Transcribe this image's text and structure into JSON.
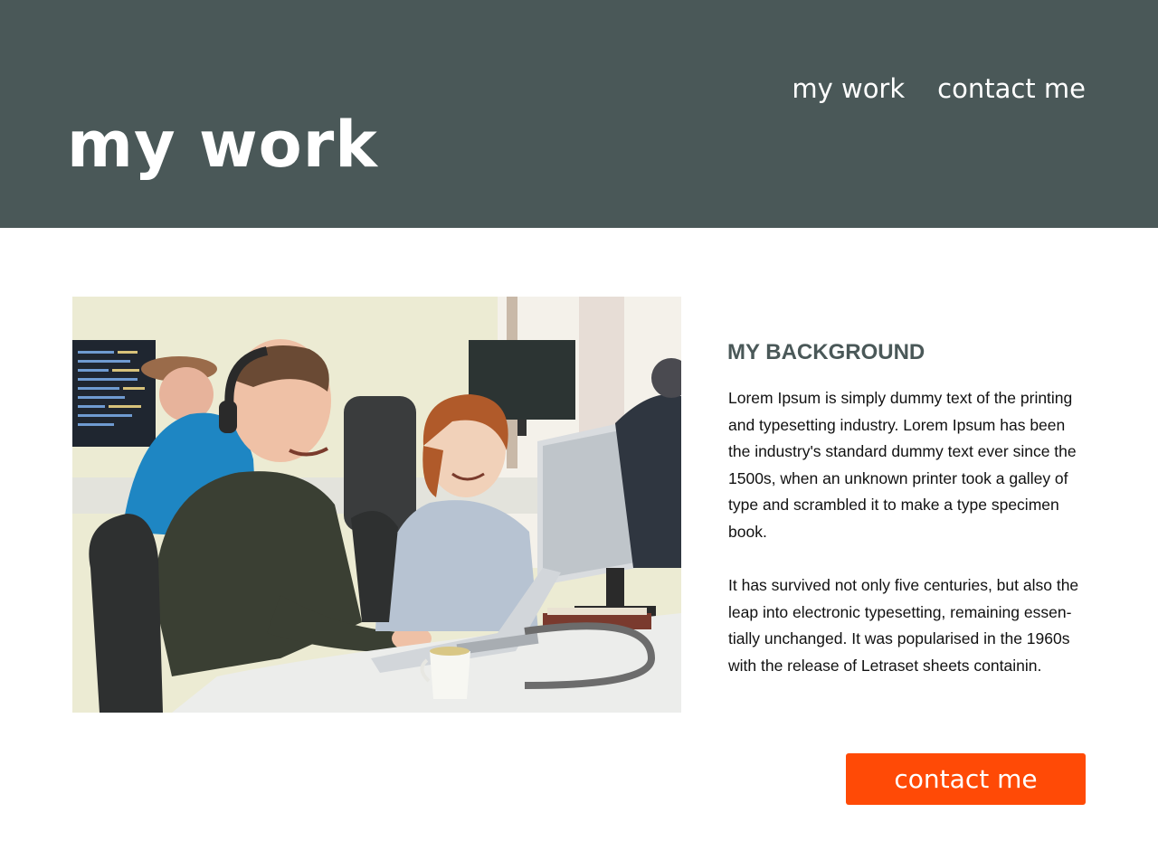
{
  "header": {
    "title": "my work",
    "nav": [
      {
        "label": "my work"
      },
      {
        "label": "contact me"
      }
    ],
    "background_color": "#4a5858"
  },
  "main": {
    "photo": {
      "alt": "Two smiling people working at computers in an office"
    },
    "section": {
      "heading": "MY BACKGROUND",
      "paragraphs": [
        "Lorem Ipsum is simply dummy text of the printing and typesetting industry. Lorem Ipsum has been the industry's standard dummy text ever since the 1500s, when an unknown printer took a galley of type and scrambled it to make a type specimen book.",
        "It has survived not only five centuries, but also the leap into electronic typesetting, remaining essen­tially unchanged. It was popularised in the 1960s with the release of Letraset sheets containin."
      ]
    },
    "cta": {
      "label": "contact me",
      "color": "#ff4a06"
    }
  }
}
